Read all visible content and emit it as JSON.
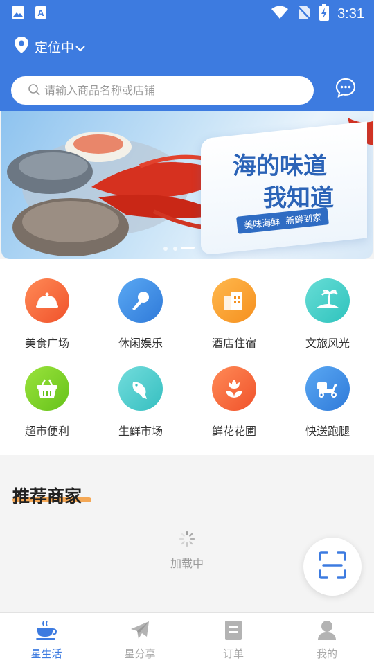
{
  "status_bar": {
    "time": "3:31",
    "left_icons": [
      "image-icon",
      "font-a-icon"
    ],
    "right_icons": [
      "wifi-icon",
      "no-sim-icon",
      "battery-charging-icon"
    ]
  },
  "location": {
    "label": "定位中",
    "icon": "location-pin-icon"
  },
  "search": {
    "placeholder": "请输入商品名称或店铺"
  },
  "banner": {
    "headline1": "海的味道",
    "headline2": "我知道",
    "tag": "美味海鲜  新鲜到家",
    "dots": 3,
    "active_dot": 2
  },
  "categories": [
    {
      "label": "美食广场",
      "icon": "food-cloche-icon",
      "color": "#f36a3c"
    },
    {
      "label": "休闲娱乐",
      "icon": "microphone-icon",
      "color": "#3d8fe6"
    },
    {
      "label": "酒店住宿",
      "icon": "hotel-building-icon",
      "color": "#f7a033"
    },
    {
      "label": "文旅风光",
      "icon": "palm-island-icon",
      "color": "#3fcfc8"
    },
    {
      "label": "超市便利",
      "icon": "shopping-basket-icon",
      "color": "#7ed321"
    },
    {
      "label": "生鲜市场",
      "icon": "fish-icon",
      "color": "#4fd0cf"
    },
    {
      "label": "鲜花花圃",
      "icon": "flower-icon",
      "color": "#f56b3f"
    },
    {
      "label": "快送跑腿",
      "icon": "scooter-icon",
      "color": "#3d8fe6"
    }
  ],
  "recommend": {
    "title": "推荐商家",
    "loading": "加载中"
  },
  "tabs": [
    {
      "label": "星生活",
      "icon": "coffee-cup-icon",
      "active": true
    },
    {
      "label": "星分享",
      "icon": "paper-plane-icon",
      "active": false
    },
    {
      "label": "订单",
      "icon": "order-doc-icon",
      "active": false
    },
    {
      "label": "我的",
      "icon": "user-icon",
      "active": false
    }
  ],
  "colors": {
    "primary": "#3d7be0",
    "accent": "#f39a3a"
  }
}
